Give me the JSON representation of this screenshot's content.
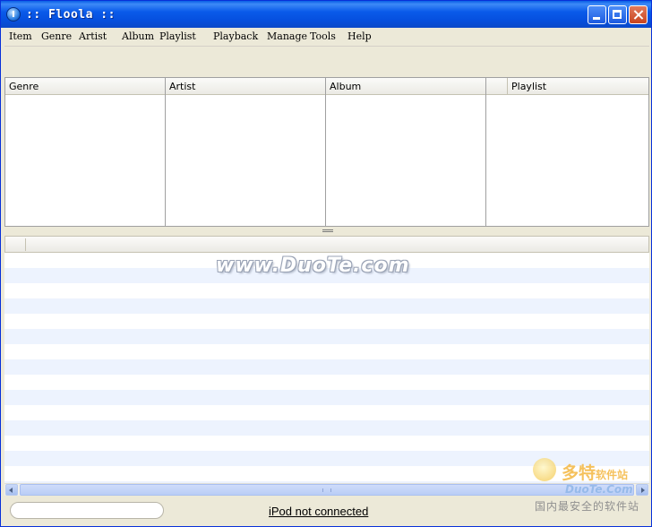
{
  "window": {
    "title": ":: Floola ::",
    "controls": {
      "minimize": "minimize-icon",
      "maximize": "maximize-icon",
      "close": "close-icon"
    }
  },
  "menu": [
    "Item",
    "Genre",
    "Artist",
    "Album",
    "Playlist",
    "Playback",
    "Manage",
    "Tools",
    "Help"
  ],
  "browser": {
    "columns": [
      "Genre",
      "Artist",
      "Album",
      "Playlist"
    ]
  },
  "watermark": {
    "text": "www.DuoTe.com"
  },
  "logo": {
    "brand_cn": "多特",
    "brand_suffix": "软件站",
    "brand_en": "DuoTe.Com",
    "tagline": "国内最安全的软件站"
  },
  "search": {
    "value": ""
  },
  "status": {
    "ipod": "iPod not connected"
  },
  "colors": {
    "titlebar": "#0A5BEA",
    "chrome": "#ECE9D8",
    "row_stripe": "#EDF3FE"
  }
}
